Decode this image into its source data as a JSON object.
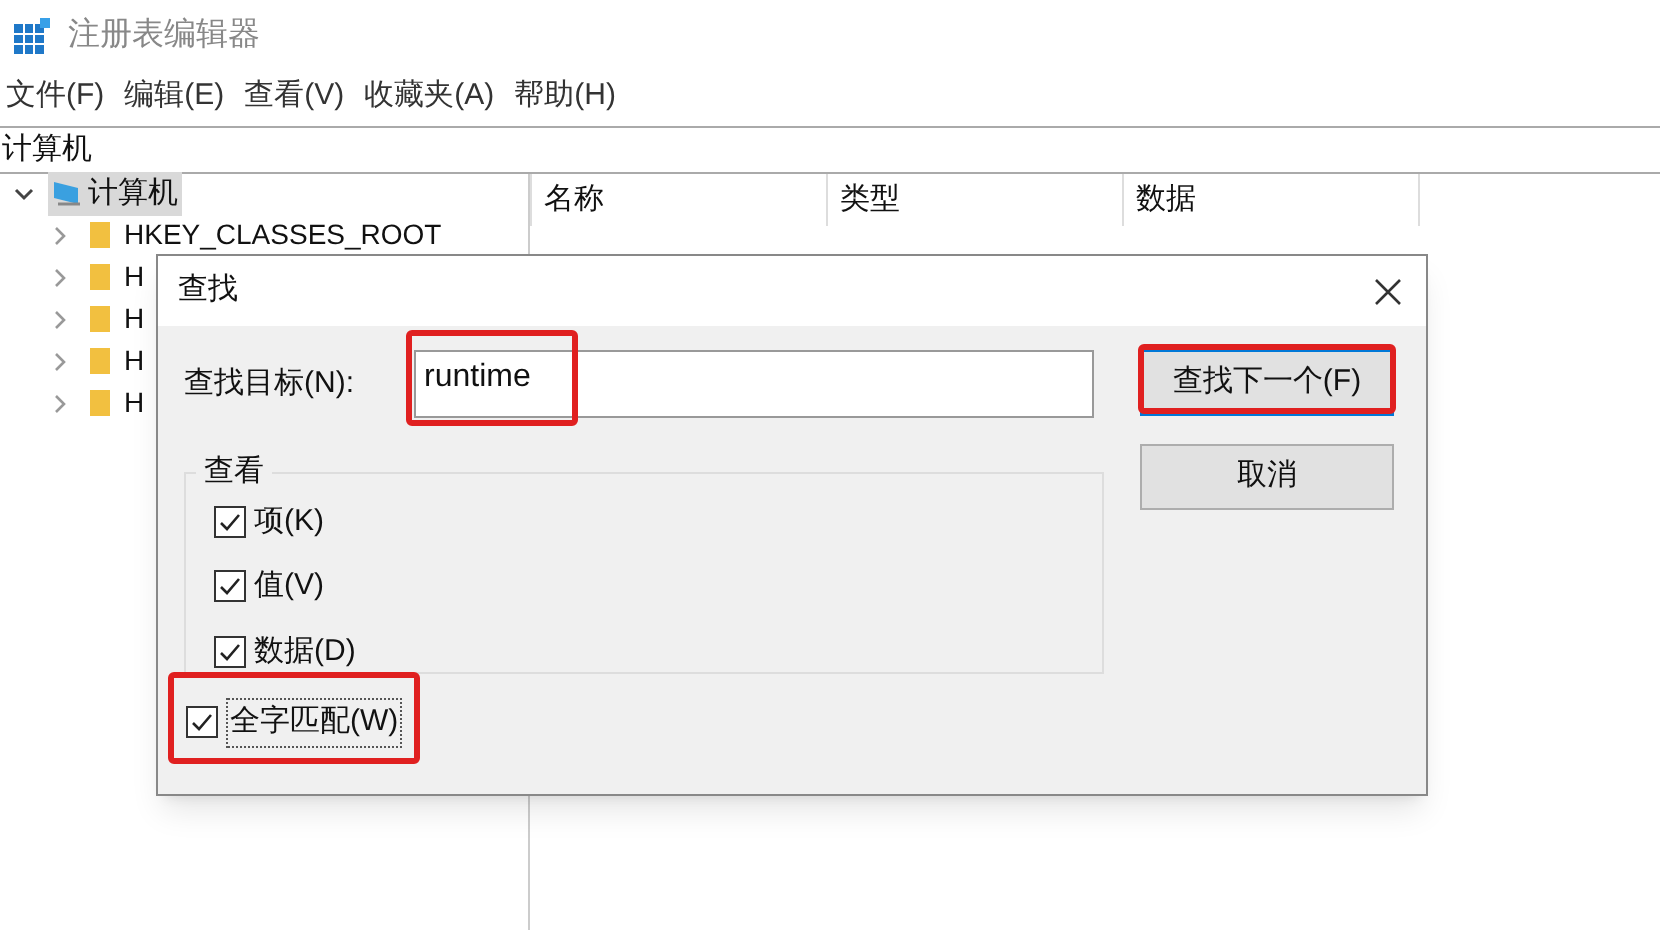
{
  "window": {
    "title": "注册表编辑器"
  },
  "menu": [
    "文件(F)",
    "编辑(E)",
    "查看(V)",
    "收藏夹(A)",
    "帮助(H)"
  ],
  "address": "计算机",
  "tree": {
    "label": "计算机",
    "expanded": true,
    "selected": true,
    "children": [
      {
        "label": "HKEY_CLASSES_ROOT",
        "expanded": false
      },
      {
        "label": "H",
        "expanded": false
      },
      {
        "label": "H",
        "expanded": false
      },
      {
        "label": "H",
        "expanded": false
      },
      {
        "label": "H",
        "expanded": false
      }
    ]
  },
  "columns": [
    "名称",
    "类型",
    "数据"
  ],
  "dialog": {
    "title": "查找",
    "find_label": "查找目标(N):",
    "find_value": "runtime",
    "find_highlighted": true,
    "buttons": [
      {
        "label": "查找下一个(F)",
        "default": true,
        "highlighted": true
      },
      {
        "label": "取消",
        "default": false,
        "highlighted": false
      }
    ],
    "group_label": "查看",
    "options": [
      {
        "label": "项(K)",
        "checked": true
      },
      {
        "label": "值(V)",
        "checked": true
      },
      {
        "label": "数据(D)",
        "checked": true
      }
    ],
    "whole_word": {
      "label": "全字匹配(W)",
      "checked": true,
      "highlighted": true
    }
  }
}
